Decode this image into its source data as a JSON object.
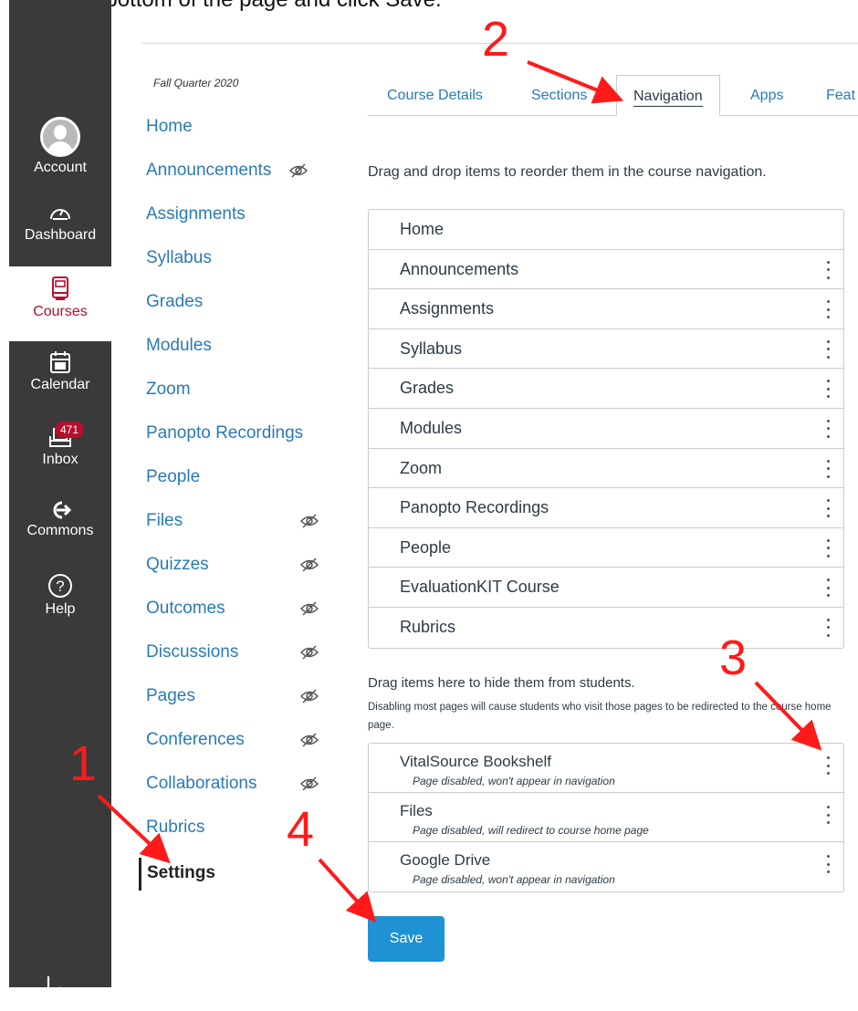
{
  "caption": {
    "text": "Go to the bottom of the page and click Save."
  },
  "global_nav": {
    "items": [
      {
        "label": "Account",
        "icon": "avatar-icon"
      },
      {
        "label": "Dashboard",
        "icon": "dashboard-icon"
      },
      {
        "label": "Courses",
        "icon": "book-icon"
      },
      {
        "label": "Calendar",
        "icon": "calendar-icon"
      },
      {
        "label": "Inbox",
        "icon": "inbox-icon",
        "badge": "471"
      },
      {
        "label": "Commons",
        "icon": "commons-icon"
      },
      {
        "label": "Help",
        "icon": "help-icon"
      }
    ],
    "collapse_glyph": "|←",
    "colors": {
      "background": "#3a3a3a",
      "active": "#b5102e"
    }
  },
  "course_nav": {
    "term": "Fall Quarter 2020",
    "items": [
      {
        "label": "Home"
      },
      {
        "label": "Announcements",
        "hidden": true
      },
      {
        "label": "Assignments"
      },
      {
        "label": "Syllabus"
      },
      {
        "label": "Grades"
      },
      {
        "label": "Modules"
      },
      {
        "label": "Zoom"
      },
      {
        "label": "Panopto Recordings"
      },
      {
        "label": "People"
      },
      {
        "label": "Files",
        "hidden": true
      },
      {
        "label": "Quizzes",
        "hidden": true
      },
      {
        "label": "Outcomes",
        "hidden": true
      },
      {
        "label": "Discussions",
        "hidden": true
      },
      {
        "label": "Pages",
        "hidden": true
      },
      {
        "label": "Conferences",
        "hidden": true
      },
      {
        "label": "Collaborations",
        "hidden": true
      },
      {
        "label": "Rubrics"
      },
      {
        "label": "Settings",
        "active": true
      }
    ]
  },
  "tabs": [
    {
      "label": "Course Details"
    },
    {
      "label": "Sections"
    },
    {
      "label": "Navigation",
      "active": true
    },
    {
      "label": "Apps"
    },
    {
      "label": "Feat"
    }
  ],
  "main": {
    "intro": "Drag and drop items to reorder them in the course navigation.",
    "nav_items": [
      "Home",
      "Announcements",
      "Assignments",
      "Syllabus",
      "Grades",
      "Modules",
      "Zoom",
      "Panopto Recordings",
      "People",
      "EvaluationKIT Course",
      "Rubrics"
    ],
    "hide_title": "Drag items here to hide them from students.",
    "hide_desc": "Disabling most pages will cause students who visit those pages to be redirected to the course home page.",
    "hidden_items": [
      {
        "name": "VitalSource Bookshelf",
        "note": "Page disabled, won't appear in navigation"
      },
      {
        "name": "Files",
        "note": "Page disabled, will redirect to course home page"
      },
      {
        "name": "Google Drive",
        "note": "Page disabled, won't appear in navigation"
      }
    ],
    "save_label": "Save",
    "colors": {
      "link": "#2a7ab7",
      "save": "#1f92d4"
    }
  },
  "annotations": {
    "numbers": [
      "1",
      "2",
      "3",
      "4"
    ],
    "color": "#ff1a1a"
  }
}
